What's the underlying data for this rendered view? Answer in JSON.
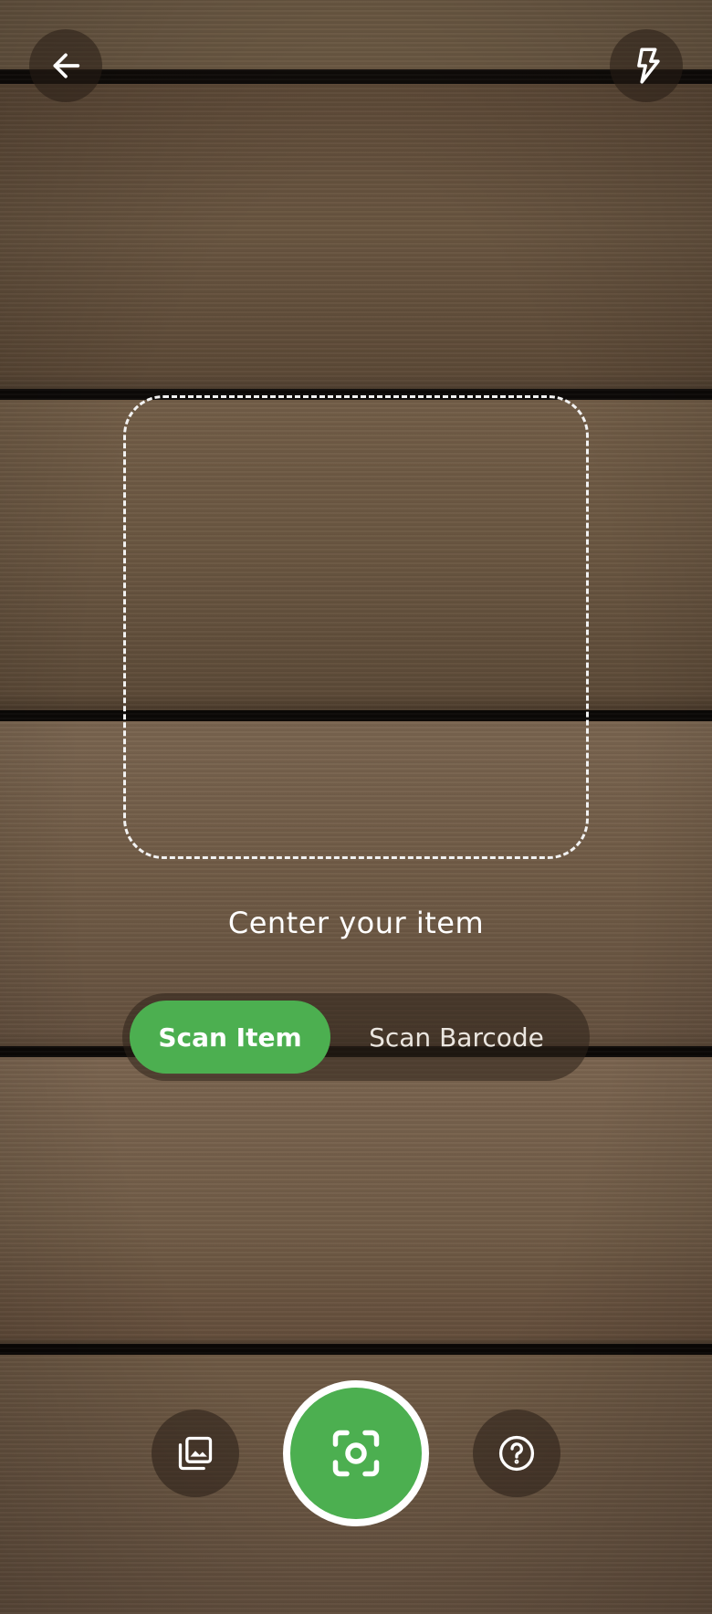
{
  "icons": {
    "back": "arrow-left-icon",
    "flash": "flash-icon",
    "gallery": "gallery-icon",
    "capture": "camera-scan-icon",
    "help": "help-icon"
  },
  "viewfinder": {
    "hint": "Center your item"
  },
  "mode_toggle": {
    "options": [
      {
        "label": "Scan Item",
        "active": true
      },
      {
        "label": "Scan Barcode",
        "active": false
      }
    ]
  },
  "colors": {
    "accent": "#4caf50",
    "frame": "#f2f2f2",
    "text": "#ffffff"
  }
}
